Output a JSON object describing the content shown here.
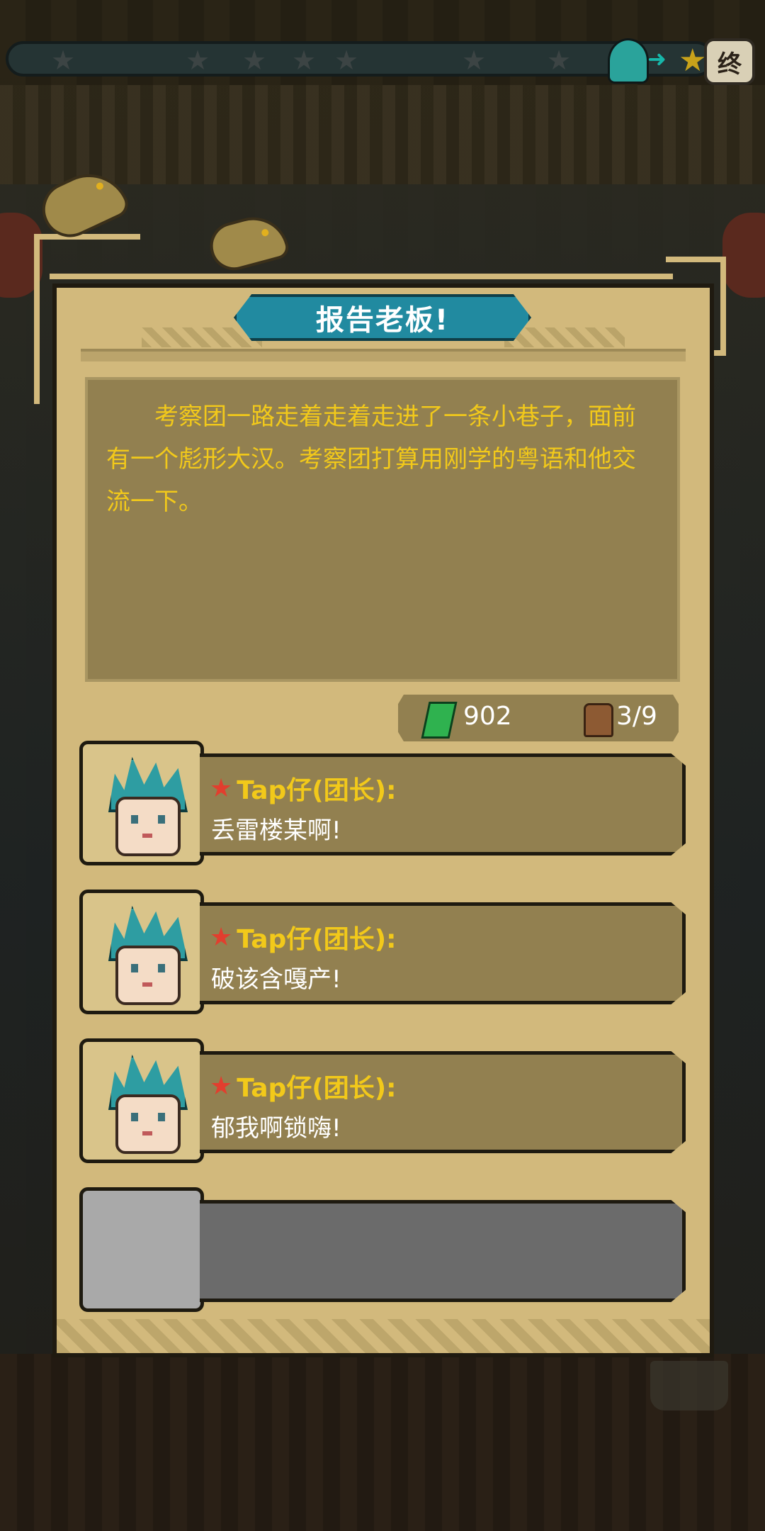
{
  "top_bar": {
    "end_label": "终"
  },
  "title": "报告老板!",
  "story": "考察团一路走着走着走进了一条小巷子，面前有一个彪形大汉。考察团打算用刚学的粤语和他交流一下。",
  "resources": {
    "money": "902",
    "bag": "3/9"
  },
  "dialogue": [
    {
      "speaker": "Tap仔(团长):",
      "line": "丢雷楼某啊!"
    },
    {
      "speaker": "Tap仔(团长):",
      "line": "破该含嘎产!"
    },
    {
      "speaker": "Tap仔(团长):",
      "line": "郁我啊锁嗨!"
    }
  ],
  "colors": {
    "panel": "#d2b97c",
    "banner": "#218aa0",
    "story_text": "#f2c91a"
  }
}
